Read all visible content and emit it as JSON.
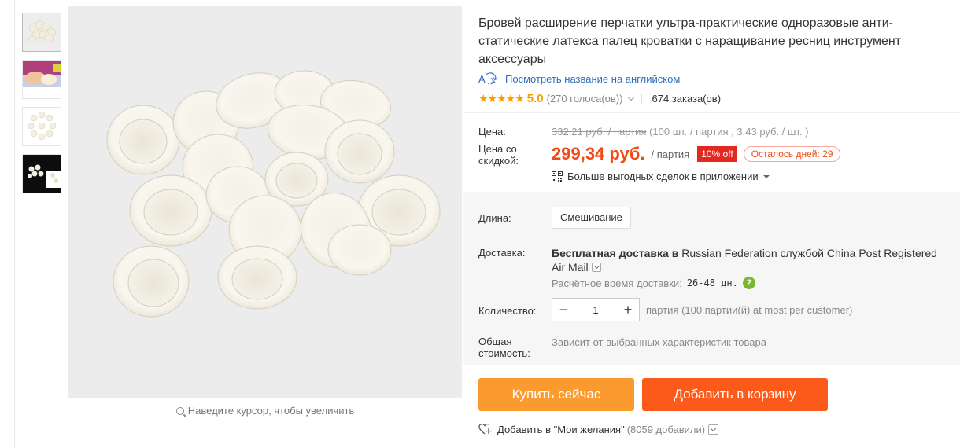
{
  "product": {
    "title": "Бровей расширение перчатки ультра-практические одноразовые анти-статические латекса палец кроватки с наращивание ресниц инструмент аксессуары",
    "translate_link": "Посмотреть название на английском",
    "rating": {
      "stars": "★★★★★",
      "score": "5.0",
      "votes": "(270 голоса(ов))",
      "orders": "674 заказа(ов)"
    }
  },
  "price": {
    "price_label": "Цена:",
    "old_price": "332,21 руб. / партия",
    "old_price_detail": " (100 шт. / партия , 3,43 руб. / шт. )",
    "discount_label": "Цена со скидкой:",
    "new_price": "299,34 руб.",
    "unit": "/ партия",
    "discount_badge": "10% off",
    "days_left": "Осталось дней: 29",
    "app_deals": "Больше выгодных сделок в приложении"
  },
  "options": {
    "length_label": "Длина:",
    "length_value": "Смешивание",
    "delivery_label": "Доставка:",
    "delivery_bold": "Бесплатная доставка в",
    "delivery_text": " Russian Federation службой China Post Registered Air Mail",
    "eta_label": "Расчётное время доставки:",
    "eta_days": "26-48 дн.",
    "help_icon": "?",
    "qty_label": "Количество:",
    "qty_minus": "−",
    "qty_value": "1",
    "qty_plus": "+",
    "qty_note": "партия (100 партии(й) at most per customer)",
    "total_label": "Общая стоимость:",
    "total_note": "Зависит от выбранных характеристик товара"
  },
  "actions": {
    "buy_now": "Купить сейчас",
    "add_to_cart": "Добавить в корзину",
    "wishlist": "Добавить в \"Мои желания\"",
    "wishlist_count": "(8059 добавили)"
  },
  "gallery": {
    "zoom_hint": "Наведите курсор, чтобы увеличить",
    "thumbnails": [
      "latex-finger-cots-pile",
      "finger-cot-on-hand",
      "finger-cots-circle",
      "finger-cots-dark-background"
    ]
  },
  "colors": {
    "accent_price": "#f04a16",
    "buy_button": "#fb9a2f",
    "cart_button": "#fb5a1b",
    "star": "#f59f00",
    "link": "#2f6fbd"
  }
}
